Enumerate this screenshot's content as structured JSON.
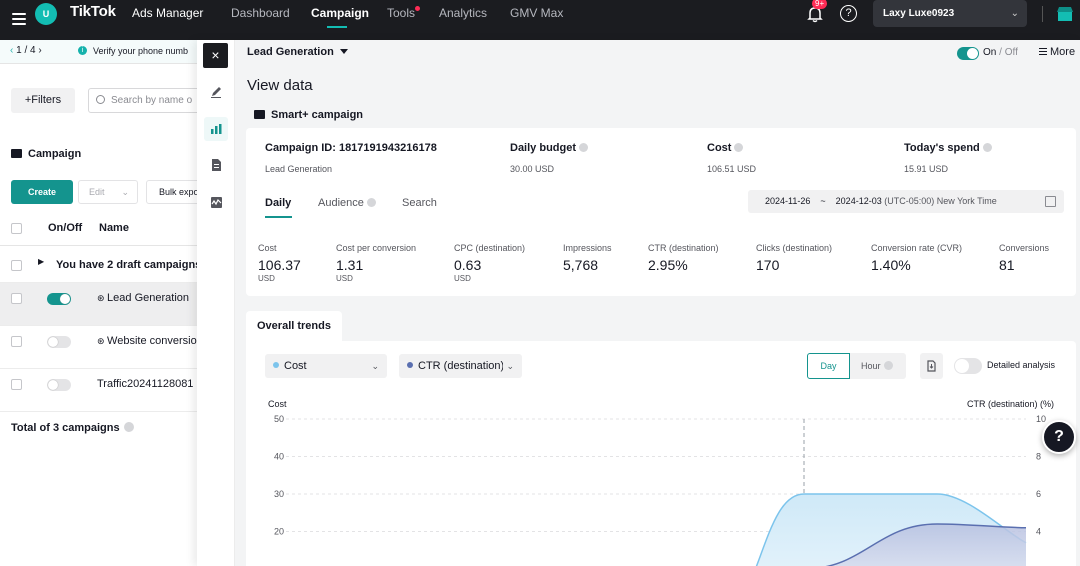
{
  "topbar": {
    "account_initial": "U",
    "brand": "TikTok",
    "brand_sub": "Ads Manager",
    "nav": [
      "Dashboard",
      "Campaign",
      "Tools",
      "Analytics",
      "GMV Max"
    ],
    "notification_badge": "9+",
    "help": "?",
    "account_name": "Laxy Luxe0923",
    "accent_color": "#13bdb3"
  },
  "left": {
    "pager": "1 / 4",
    "pager_prev": "‹",
    "pager_next": "›",
    "verify_text": "Verify your phone numb",
    "filters": "+Filters",
    "search_placeholder": "Search by name o",
    "section_title": "Campaign",
    "create": "Create",
    "edit": "Edit",
    "bulk": "Bulk expo",
    "col_onoff": "On/Off",
    "col_name": "Name",
    "draft_row": "You have 2 draft campaigns",
    "rows": [
      {
        "name": "Lead Generation",
        "on": true
      },
      {
        "name": "Website conversio",
        "on": false
      },
      {
        "name": "Traffic20241128081",
        "on": false
      }
    ],
    "total": "Total of 3 campaigns"
  },
  "drawer": {
    "close": "×",
    "objective": "Lead Generation",
    "onoff_on": "On",
    "onoff_off": "Off",
    "onoff_sep": " / ",
    "more": "More",
    "title": "View data",
    "campaign_type": "Smart+ campaign",
    "summary": {
      "campaign_id_label": "Campaign ID: 1817191943216178",
      "campaign_sub": "Lead Generation",
      "budget_label": "Daily budget",
      "budget_value": "30.00 USD",
      "cost_label": "Cost",
      "cost_value": "106.51 USD",
      "spend_label": "Today's spend",
      "spend_value": "15.91 USD"
    },
    "tabs": [
      "Daily",
      "Audience",
      "Search"
    ],
    "date_start": "2024-11-26",
    "date_sep": "~",
    "date_end": "2024-12-03",
    "timezone": "(UTC-05:00) New York Time",
    "metrics": [
      {
        "label": "Cost",
        "value": "106.37",
        "unit": "USD"
      },
      {
        "label": "Cost per conversion",
        "value": "1.31",
        "unit": "USD"
      },
      {
        "label": "CPC (destination)",
        "value": "0.63",
        "unit": "USD"
      },
      {
        "label": "Impressions",
        "value": "5,768",
        "unit": ""
      },
      {
        "label": "CTR (destination)",
        "value": "2.95%",
        "unit": ""
      },
      {
        "label": "Clicks (destination)",
        "value": "170",
        "unit": ""
      },
      {
        "label": "Conversion rate (CVR)",
        "value": "1.40%",
        "unit": ""
      },
      {
        "label": "Conversions",
        "value": "81",
        "unit": ""
      }
    ],
    "trends_tab": "Overall trends",
    "metric_select_1": "Cost",
    "metric_select_2": "CTR (destination)",
    "day": "Day",
    "hour": "Hour",
    "detailed": "Detailed analysis"
  },
  "chart_data": {
    "type": "area",
    "ylabel": "Cost",
    "y2label": "CTR (destination) (%)",
    "ylim": [
      0,
      50
    ],
    "y2lim": [
      0,
      10
    ],
    "yticks": [
      50,
      40,
      30,
      20
    ],
    "y2ticks": [
      10,
      8,
      6,
      4
    ],
    "series": [
      {
        "name": "Cost",
        "color": "#7cc4ec",
        "points": [
          [
            0.62,
            14
          ],
          [
            0.7,
            30
          ],
          [
            0.88,
            30
          ],
          [
            1.0,
            17
          ]
        ]
      },
      {
        "name": "CTR (destination)",
        "color": "#5a6fb0",
        "axis": "y2",
        "points": [
          [
            0.7,
            2
          ],
          [
            0.88,
            4.4
          ],
          [
            1.0,
            4.2
          ]
        ]
      }
    ]
  },
  "float_help": "?"
}
